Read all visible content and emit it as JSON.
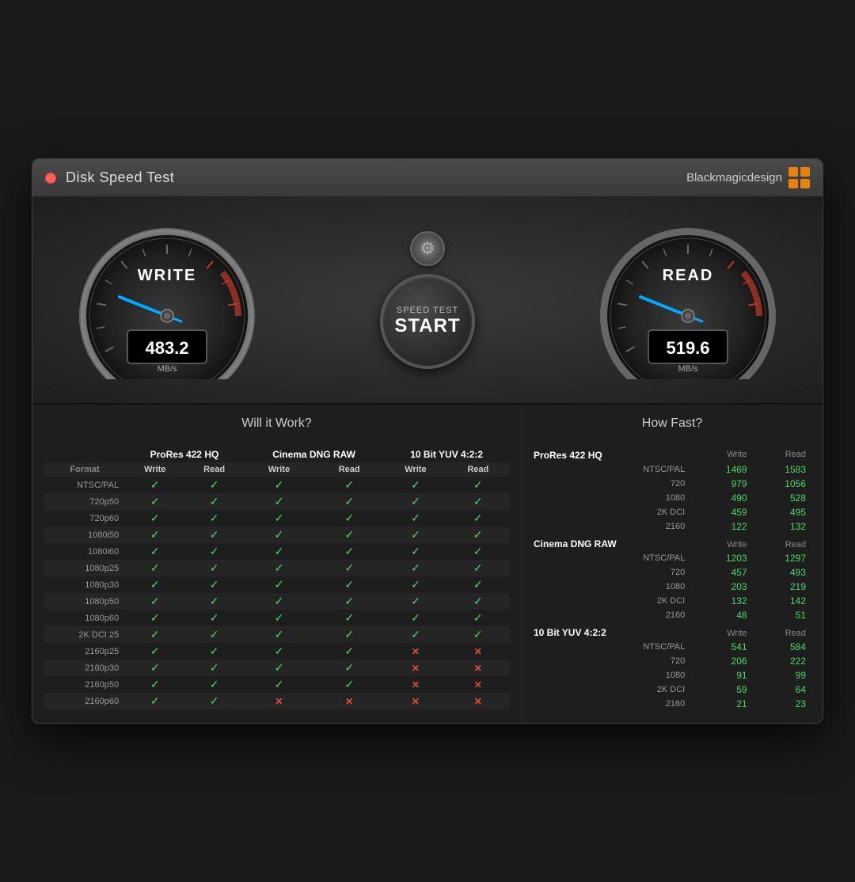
{
  "window": {
    "title": "Disk Speed Test",
    "brand": "Blackmagicdesign",
    "close_label": "×"
  },
  "gauges": {
    "write": {
      "label": "WRITE",
      "value": "483.2",
      "unit": "MB/s"
    },
    "read": {
      "label": "READ",
      "value": "519.6",
      "unit": "MB/s"
    },
    "start_button": {
      "line1": "SPEED TEST",
      "line2": "START"
    },
    "settings_icon": "⚙"
  },
  "sections": {
    "left_header": "Will it Work?",
    "right_header": "How Fast?"
  },
  "compat_headers": [
    "ProRes 422 HQ",
    "Cinema DNG RAW",
    "10 Bit YUV 4:2:2"
  ],
  "compat_subheaders": [
    "Write",
    "Read",
    "Write",
    "Read",
    "Write",
    "Read"
  ],
  "compat_rows": [
    {
      "format": "NTSC/PAL",
      "vals": [
        1,
        1,
        1,
        1,
        1,
        1
      ]
    },
    {
      "format": "720p50",
      "vals": [
        1,
        1,
        1,
        1,
        1,
        1
      ]
    },
    {
      "format": "720p60",
      "vals": [
        1,
        1,
        1,
        1,
        1,
        1
      ]
    },
    {
      "format": "1080i50",
      "vals": [
        1,
        1,
        1,
        1,
        1,
        1
      ]
    },
    {
      "format": "1080i60",
      "vals": [
        1,
        1,
        1,
        1,
        1,
        1
      ]
    },
    {
      "format": "1080p25",
      "vals": [
        1,
        1,
        1,
        1,
        1,
        1
      ]
    },
    {
      "format": "1080p30",
      "vals": [
        1,
        1,
        1,
        1,
        1,
        1
      ]
    },
    {
      "format": "1080p50",
      "vals": [
        1,
        1,
        1,
        1,
        1,
        1
      ]
    },
    {
      "format": "1080p60",
      "vals": [
        1,
        1,
        1,
        1,
        1,
        1
      ]
    },
    {
      "format": "2K DCI 25",
      "vals": [
        1,
        1,
        1,
        1,
        1,
        1
      ]
    },
    {
      "format": "2160p25",
      "vals": [
        1,
        1,
        1,
        1,
        0,
        0
      ]
    },
    {
      "format": "2160p30",
      "vals": [
        1,
        1,
        1,
        1,
        0,
        0
      ]
    },
    {
      "format": "2160p50",
      "vals": [
        1,
        1,
        1,
        1,
        0,
        0
      ]
    },
    {
      "format": "2160p60",
      "vals": [
        1,
        1,
        0,
        0,
        0,
        0
      ]
    }
  ],
  "speed_data": [
    {
      "section": "ProRes 422 HQ",
      "rows": [
        {
          "format": "NTSC/PAL",
          "write": "1469",
          "read": "1583"
        },
        {
          "format": "720",
          "write": "979",
          "read": "1056"
        },
        {
          "format": "1080",
          "write": "490",
          "read": "528"
        },
        {
          "format": "2K DCI",
          "write": "459",
          "read": "495"
        },
        {
          "format": "2160",
          "write": "122",
          "read": "132"
        }
      ]
    },
    {
      "section": "Cinema DNG RAW",
      "rows": [
        {
          "format": "NTSC/PAL",
          "write": "1203",
          "read": "1297"
        },
        {
          "format": "720",
          "write": "457",
          "read": "493"
        },
        {
          "format": "1080",
          "write": "203",
          "read": "219"
        },
        {
          "format": "2K DCI",
          "write": "132",
          "read": "142"
        },
        {
          "format": "2160",
          "write": "48",
          "read": "51"
        }
      ]
    },
    {
      "section": "10 Bit YUV 4:2:2",
      "rows": [
        {
          "format": "NTSC/PAL",
          "write": "541",
          "read": "584"
        },
        {
          "format": "720",
          "write": "206",
          "read": "222"
        },
        {
          "format": "1080",
          "write": "91",
          "read": "99"
        },
        {
          "format": "2K DCI",
          "write": "59",
          "read": "64"
        },
        {
          "format": "2160",
          "write": "21",
          "read": "23"
        }
      ]
    }
  ],
  "write_col_label": "Write",
  "read_col_label": "Read",
  "format_col_label": "Format"
}
